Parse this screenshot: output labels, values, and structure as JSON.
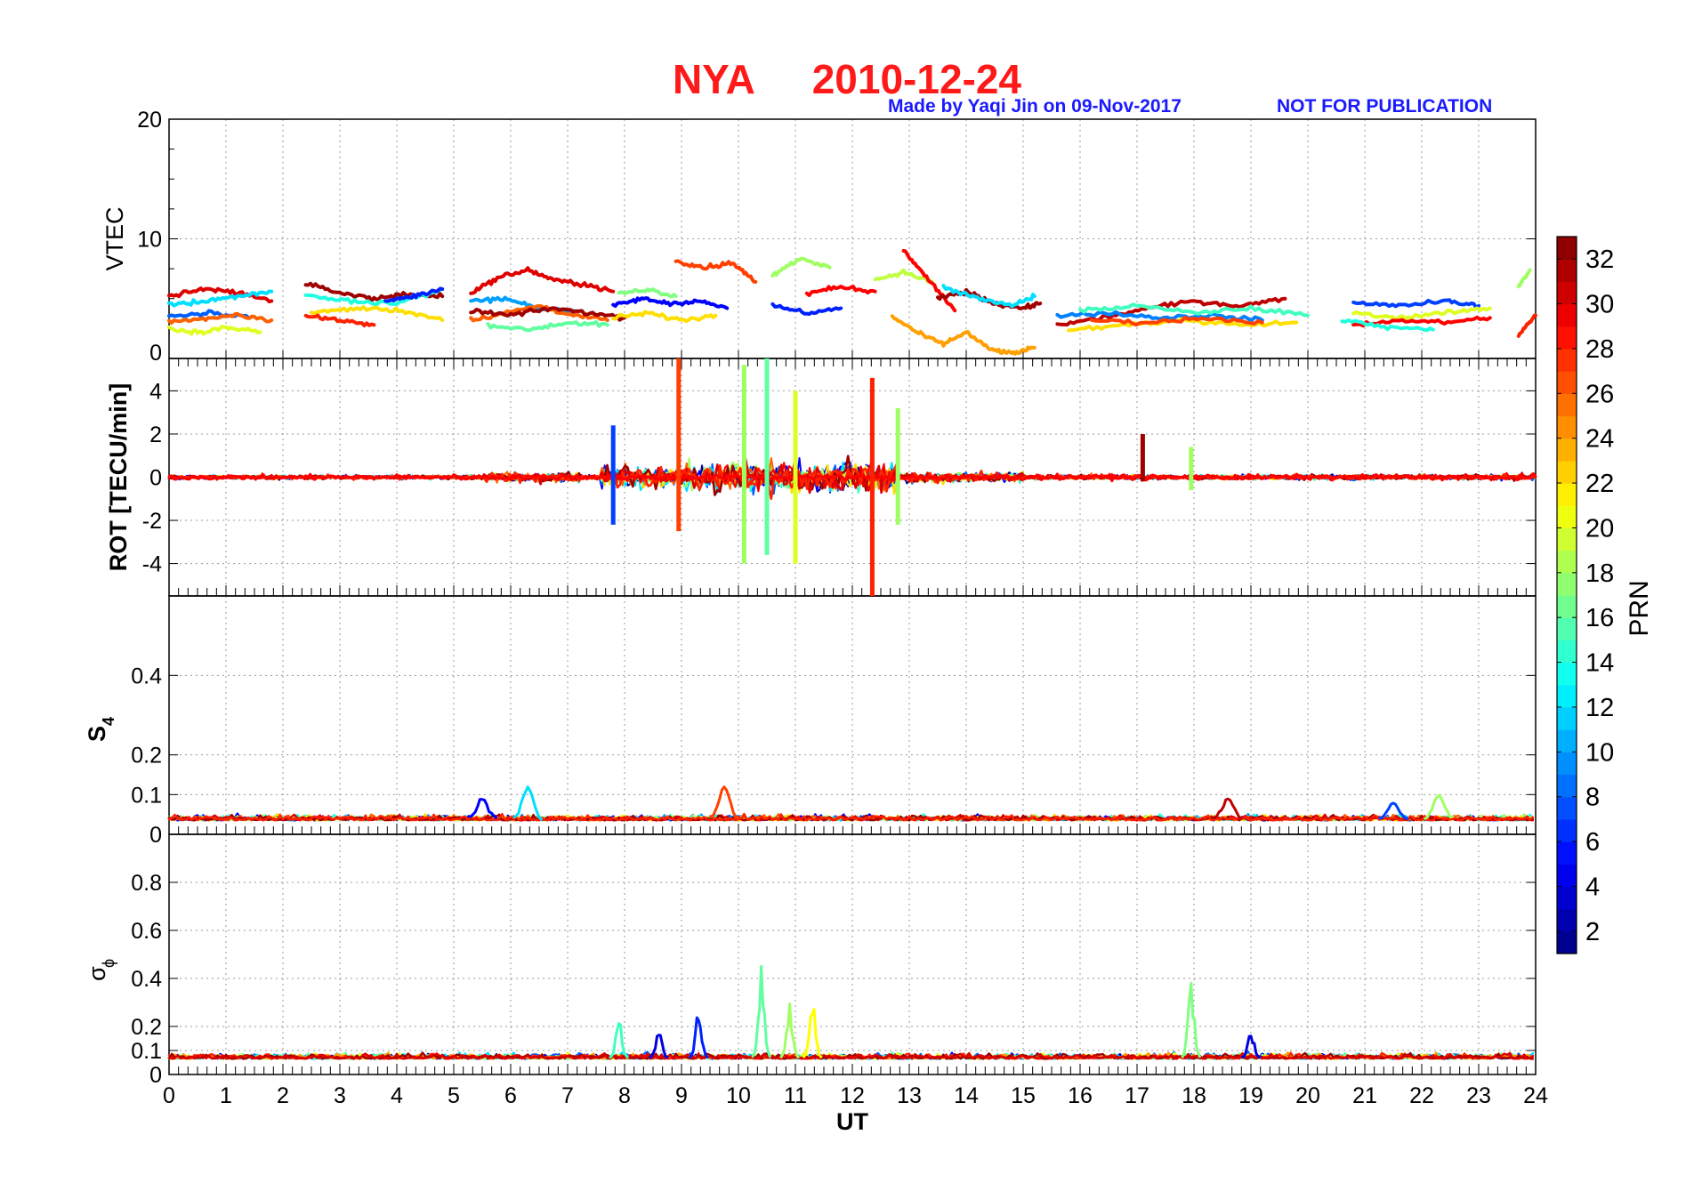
{
  "title": {
    "station": "NYA",
    "date": "2010-12-24",
    "color": "#ff1a1a"
  },
  "credit": {
    "made_by": "Made by Yaqi Jin on 09-Nov-2017",
    "notice": "NOT FOR PUBLICATION",
    "color": "#1a1aff"
  },
  "chart_data": [
    {
      "type": "line",
      "panel": "vtec",
      "ylabel": "VTEC",
      "xlabel": "",
      "xlim": [
        0,
        24
      ],
      "ylim": [
        0,
        20
      ],
      "yticks": [
        0,
        10,
        20
      ],
      "grid": true,
      "note": "curves colored by PRN; values estimated",
      "series": [
        {
          "prn": 30,
          "x": [
            0,
            0.6,
            1.2,
            1.8
          ],
          "y": [
            5.2,
            5.8,
            5.5,
            4.8
          ]
        },
        {
          "prn": 12,
          "x": [
            0,
            0.6,
            1.2,
            1.8
          ],
          "y": [
            4.5,
            4.8,
            5.2,
            5.6
          ]
        },
        {
          "prn": 20,
          "x": [
            0,
            0.5,
            1.0,
            1.6
          ],
          "y": [
            2.5,
            2.2,
            2.6,
            2.2
          ]
        },
        {
          "prn": 8,
          "x": [
            0,
            0.7,
            1.4
          ],
          "y": [
            3.5,
            3.8,
            3.4
          ]
        },
        {
          "prn": 26,
          "x": [
            0,
            0.6,
            1.2,
            1.8
          ],
          "y": [
            3.0,
            3.3,
            3.6,
            3.2
          ]
        },
        {
          "prn": 32,
          "x": [
            2.4,
            3.0,
            3.6,
            4.2,
            4.8
          ],
          "y": [
            6.2,
            5.5,
            5.0,
            5.4,
            5.2
          ]
        },
        {
          "prn": 14,
          "x": [
            2.4,
            3.2,
            4.0,
            4.8
          ],
          "y": [
            5.2,
            4.8,
            4.6,
            5.8
          ]
        },
        {
          "prn": 22,
          "x": [
            2.5,
            3.3,
            4.1,
            4.8
          ],
          "y": [
            3.8,
            4.2,
            4.0,
            3.2
          ]
        },
        {
          "prn": 28,
          "x": [
            2.4,
            3.0,
            3.6
          ],
          "y": [
            3.5,
            3.2,
            2.8
          ]
        },
        {
          "prn": 6,
          "x": [
            3.8,
            4.3,
            4.8
          ],
          "y": [
            4.8,
            5.2,
            5.8
          ]
        },
        {
          "prn": 30,
          "x": [
            5.3,
            5.8,
            6.3,
            6.8,
            7.3,
            7.8
          ],
          "y": [
            5.5,
            6.8,
            7.4,
            6.5,
            6.2,
            5.6
          ]
        },
        {
          "prn": 10,
          "x": [
            5.3,
            5.9,
            6.5,
            7.1
          ],
          "y": [
            4.8,
            5.0,
            4.2,
            4.0
          ]
        },
        {
          "prn": 26,
          "x": [
            5.3,
            5.9,
            6.5,
            7.1,
            7.7
          ],
          "y": [
            3.2,
            3.8,
            4.4,
            3.6,
            3.2
          ]
        },
        {
          "prn": 32,
          "x": [
            5.3,
            6.0,
            6.7,
            7.4,
            8.0
          ],
          "y": [
            4.0,
            3.6,
            4.2,
            3.8,
            3.4
          ]
        },
        {
          "prn": 16,
          "x": [
            5.6,
            6.3,
            7.0,
            7.7
          ],
          "y": [
            2.8,
            2.4,
            3.0,
            2.8
          ]
        },
        {
          "prn": 5,
          "x": [
            7.8,
            8.3,
            8.8,
            9.3,
            9.8
          ],
          "y": [
            4.4,
            5.0,
            4.6,
            4.8,
            4.2
          ]
        },
        {
          "prn": 22,
          "x": [
            7.8,
            8.4,
            9.0,
            9.6
          ],
          "y": [
            3.4,
            3.8,
            3.2,
            3.6
          ]
        },
        {
          "prn": 27,
          "x": [
            8.9,
            9.4,
            9.9,
            10.3
          ],
          "y": [
            8.2,
            7.6,
            8.0,
            6.4
          ]
        },
        {
          "prn": 17,
          "x": [
            7.9,
            8.4,
            8.9
          ],
          "y": [
            5.4,
            5.8,
            5.2
          ]
        },
        {
          "prn": 18,
          "x": [
            10.6,
            11.1,
            11.6
          ],
          "y": [
            7.0,
            8.4,
            7.6
          ]
        },
        {
          "prn": 6,
          "x": [
            10.6,
            11.2,
            11.8
          ],
          "y": [
            4.4,
            3.8,
            4.2
          ]
        },
        {
          "prn": 29,
          "x": [
            11.2,
            11.8,
            12.4
          ],
          "y": [
            5.4,
            6.0,
            5.6
          ]
        },
        {
          "prn": 19,
          "x": [
            12.4,
            12.9,
            13.4
          ],
          "y": [
            6.6,
            7.2,
            6.4
          ]
        },
        {
          "prn": 29,
          "x": [
            12.9,
            13.3,
            13.8
          ],
          "y": [
            9.0,
            6.8,
            4.0
          ]
        },
        {
          "prn": 24,
          "x": [
            12.7,
            13.2,
            13.6,
            14.0,
            14.4,
            14.8,
            15.2
          ],
          "y": [
            3.5,
            2.0,
            1.2,
            2.2,
            0.8,
            0.4,
            0.9
          ]
        },
        {
          "prn": 32,
          "x": [
            13.5,
            14.0,
            14.5,
            15.0,
            15.3
          ],
          "y": [
            5.0,
            5.6,
            4.6,
            4.2,
            4.6
          ]
        },
        {
          "prn": 12,
          "x": [
            13.6,
            14.2,
            14.8,
            15.2
          ],
          "y": [
            6.0,
            5.0,
            4.4,
            5.2
          ]
        },
        {
          "prn": 31,
          "x": [
            15.6,
            16.4,
            17.2,
            18.0,
            18.8,
            19.6
          ],
          "y": [
            2.8,
            3.4,
            4.2,
            4.8,
            4.4,
            5.0
          ]
        },
        {
          "prn": 9,
          "x": [
            15.6,
            16.5,
            17.4,
            18.3,
            19.2
          ],
          "y": [
            3.6,
            3.8,
            3.4,
            3.6,
            3.2
          ]
        },
        {
          "prn": 22,
          "x": [
            15.8,
            16.8,
            17.8,
            18.8,
            19.8
          ],
          "y": [
            2.4,
            2.8,
            3.2,
            2.8,
            3.0
          ]
        },
        {
          "prn": 15,
          "x": [
            16.0,
            17.0,
            18.0,
            19.0,
            20.0
          ],
          "y": [
            4.0,
            4.4,
            3.8,
            4.2,
            3.6
          ]
        },
        {
          "prn": 27,
          "x": [
            16.2,
            17.2,
            18.2,
            19.2
          ],
          "y": [
            3.2,
            3.0,
            3.4,
            3.0
          ]
        },
        {
          "prn": 7,
          "x": [
            20.8,
            21.6,
            22.4,
            23.0
          ],
          "y": [
            4.6,
            4.4,
            4.8,
            4.4
          ]
        },
        {
          "prn": 20,
          "x": [
            20.8,
            21.6,
            22.4,
            23.2
          ],
          "y": [
            3.8,
            3.4,
            3.8,
            4.2
          ]
        },
        {
          "prn": 29,
          "x": [
            20.8,
            21.6,
            22.4,
            23.2
          ],
          "y": [
            2.8,
            3.2,
            3.0,
            3.4
          ]
        },
        {
          "prn": 14,
          "x": [
            20.6,
            21.4,
            22.2
          ],
          "y": [
            3.2,
            2.6,
            2.4
          ]
        },
        {
          "prn": 18,
          "x": [
            23.7,
            23.9
          ],
          "y": [
            6.0,
            7.4
          ]
        },
        {
          "prn": 28,
          "x": [
            23.7,
            24.0
          ],
          "y": [
            2.0,
            3.6
          ]
        }
      ]
    },
    {
      "type": "line",
      "panel": "rot",
      "ylabel": "ROT [TECU/min]",
      "xlabel": "",
      "xlim": [
        0,
        24
      ],
      "ylim": [
        -5.5,
        5.5
      ],
      "yticks": [
        -4,
        -2,
        0,
        2,
        4
      ],
      "grid": true,
      "note": "noisy traces around zero; spike values estimated",
      "spikes": [
        {
          "prn": 27,
          "x": 8.95,
          "y": [
            -2.5,
            5.5
          ]
        },
        {
          "prn": 18,
          "x": 10.1,
          "y": [
            -4.0,
            5.2
          ]
        },
        {
          "prn": 16,
          "x": 10.5,
          "y": [
            -3.6,
            5.5
          ]
        },
        {
          "prn": 20,
          "x": 11.0,
          "y": [
            -4.0,
            4.0
          ]
        },
        {
          "prn": 28,
          "x": 12.35,
          "y": [
            -5.5,
            4.6
          ]
        },
        {
          "prn": 7,
          "x": 7.8,
          "y": [
            -2.2,
            2.4
          ]
        },
        {
          "prn": 18,
          "x": 12.8,
          "y": [
            -2.2,
            3.2
          ]
        },
        {
          "prn": 32,
          "x": 17.1,
          "y": [
            -0.2,
            2.0
          ]
        },
        {
          "prn": 18,
          "x": 17.95,
          "y": [
            -0.6,
            1.4
          ]
        }
      ]
    },
    {
      "type": "line",
      "panel": "s4",
      "ylabel": "S4",
      "ylabel_main": "S",
      "ylabel_sub": "4",
      "xlabel": "",
      "xlim": [
        0,
        24
      ],
      "ylim": [
        0,
        0.6
      ],
      "ytick_labels": [
        "0",
        "0.1",
        "0.2",
        "0.4"
      ],
      "yticks": [
        0,
        0.1,
        0.2,
        0.4
      ],
      "grid": true,
      "note": "baseline ~0.04 with small bursts; values estimated",
      "peaks": [
        {
          "prn": 27,
          "x": 9.75,
          "y": 0.12
        },
        {
          "prn": 12,
          "x": 6.3,
          "y": 0.12
        },
        {
          "prn": 5,
          "x": 5.5,
          "y": 0.09
        },
        {
          "prn": 31,
          "x": 18.6,
          "y": 0.09
        },
        {
          "prn": 7,
          "x": 21.5,
          "y": 0.08
        },
        {
          "prn": 18,
          "x": 22.3,
          "y": 0.1
        }
      ]
    },
    {
      "type": "line",
      "panel": "sigma_phi",
      "ylabel_main": "σ",
      "ylabel_sub": "ϕ",
      "xlabel": "UT",
      "xlim": [
        0,
        24
      ],
      "xticks": [
        0,
        1,
        2,
        3,
        4,
        5,
        6,
        7,
        8,
        9,
        10,
        11,
        12,
        13,
        14,
        15,
        16,
        17,
        18,
        19,
        20,
        21,
        22,
        23,
        24
      ],
      "ylim": [
        0,
        1
      ],
      "ytick_labels": [
        "0",
        "0.1",
        "0.2",
        "0.4",
        "0.6",
        "0.8"
      ],
      "yticks": [
        0,
        0.1,
        0.2,
        0.4,
        0.6,
        0.8
      ],
      "grid": true,
      "note": "baseline ~0.07 with bursts; values estimated",
      "peaks": [
        {
          "prn": 16,
          "x": 10.4,
          "y": 0.46
        },
        {
          "prn": 17,
          "x": 17.95,
          "y": 0.39
        },
        {
          "prn": 21,
          "x": 11.3,
          "y": 0.33
        },
        {
          "prn": 6,
          "x": 9.3,
          "y": 0.27
        },
        {
          "prn": 4,
          "x": 8.6,
          "y": 0.2
        },
        {
          "prn": 15,
          "x": 7.9,
          "y": 0.24
        },
        {
          "prn": 4,
          "x": 19.0,
          "y": 0.19
        },
        {
          "prn": 18,
          "x": 10.9,
          "y": 0.3
        }
      ]
    }
  ],
  "colorbar": {
    "label": "PRN",
    "min": 1,
    "max": 33,
    "ticks": [
      2,
      4,
      6,
      8,
      10,
      12,
      14,
      16,
      18,
      20,
      22,
      24,
      26,
      28,
      30,
      32
    ]
  }
}
